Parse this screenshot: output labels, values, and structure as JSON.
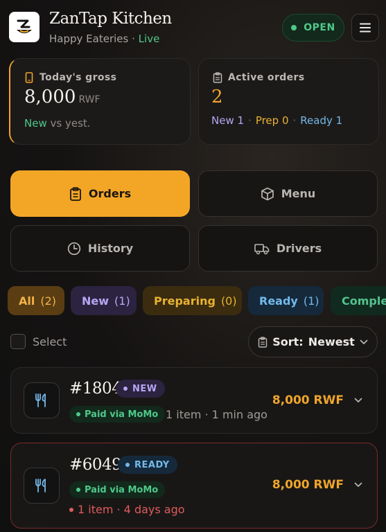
{
  "header": {
    "title": "ZanTap Kitchen",
    "subtitle": "Happy Eateries",
    "subtitle_sep": "·",
    "live": "Live",
    "status": "OPEN"
  },
  "stats": {
    "gross": {
      "label": "Today's gross",
      "value": "8,000",
      "unit": "RWF",
      "trend": "New",
      "trend_suffix": "vs yest."
    },
    "active": {
      "label": "Active orders",
      "value": "2",
      "new": "New 1",
      "prep": "Prep 0",
      "ready": "Ready 1",
      "sep": "·"
    }
  },
  "nav": {
    "orders": "Orders",
    "menu": "Menu",
    "history": "History",
    "drivers": "Drivers"
  },
  "filters": [
    {
      "label": "All",
      "count": "(2)"
    },
    {
      "label": "New",
      "count": "(1)"
    },
    {
      "label": "Preparing",
      "count": "(0)"
    },
    {
      "label": "Ready",
      "count": "(1)"
    },
    {
      "label": "Completed",
      "count": ""
    }
  ],
  "toolbar": {
    "select_label": "Select",
    "sort_label": "Sort:",
    "sort_value": "Newest"
  },
  "orders": [
    {
      "number": "#1804",
      "status": "NEW",
      "payment": "Paid via MoMo",
      "meta": "1 item · 1 min ago",
      "total": "8,000 RWF"
    },
    {
      "number": "#6049",
      "status": "READY",
      "payment": "Paid via MoMo",
      "meta": "1 item · 4 days ago",
      "total": "8,000 RWF"
    }
  ],
  "colors": {
    "accent": "#f3a626",
    "open_green": "#4fc88a",
    "new_purple": "#b7a6f2",
    "ready_blue": "#74b9ea",
    "alert_red": "#e05b5b"
  }
}
